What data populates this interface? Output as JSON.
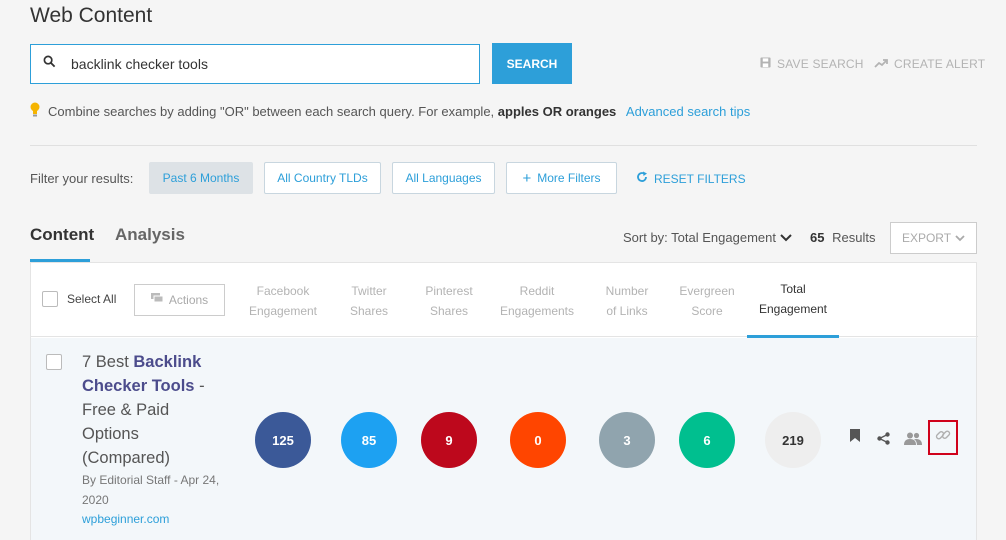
{
  "page_title": "Web Content",
  "search": {
    "value": "backlink checker tools",
    "button": "SEARCH"
  },
  "top_actions": {
    "save_search": "SAVE SEARCH",
    "create_alert": "CREATE ALERT"
  },
  "tip": {
    "prefix": "Combine searches by adding \"OR\" between each search query. For example,",
    "example": "apples OR oranges",
    "link": "Advanced search tips"
  },
  "filters": {
    "label": "Filter your results:",
    "chips": [
      "Past 6 Months",
      "All Country TLDs",
      "All Languages",
      "More Filters"
    ],
    "reset": "RESET FILTERS"
  },
  "tabs": [
    "Content",
    "Analysis"
  ],
  "sort": {
    "label": "Sort by: Total Engagement",
    "count": "65",
    "results_label": "Results",
    "export": "EXPORT"
  },
  "table": {
    "select_all": "Select All",
    "actions": "Actions",
    "columns": [
      [
        "Facebook",
        "Engagement"
      ],
      [
        "Twitter",
        "Shares"
      ],
      [
        "Pinterest",
        "Shares"
      ],
      [
        "Reddit",
        "Engagements"
      ],
      [
        "Number",
        "of Links"
      ],
      [
        "Evergreen",
        "Score"
      ],
      [
        "Total",
        "Engagement"
      ]
    ],
    "rows": [
      {
        "title_pre": "7 Best ",
        "title_bold": "Backlink Checker Tools",
        "title_post": " - Free & Paid Options (Compared)",
        "byline": "By Editorial Staff - Apr 24, 2020",
        "domain": "wpbeginner.com",
        "metrics": [
          "125",
          "85",
          "9",
          "0",
          "3",
          "6",
          "219"
        ]
      }
    ]
  },
  "colors": {
    "accent": "#2d9fd9",
    "facebook": "#3b5998",
    "twitter": "#1da1f2",
    "pinterest": "#bd081c",
    "reddit": "#ff4500",
    "links": "#90a4ae",
    "evergreen": "#00bf8f",
    "total": "#eeeeee"
  },
  "icons": [
    "search-icon",
    "floppy-icon",
    "trend-icon",
    "lightbulb-icon",
    "plus-icon",
    "refresh-icon",
    "chevron-down-icon",
    "comment-icon",
    "bookmark-icon",
    "share-icon",
    "users-icon",
    "link-icon"
  ]
}
